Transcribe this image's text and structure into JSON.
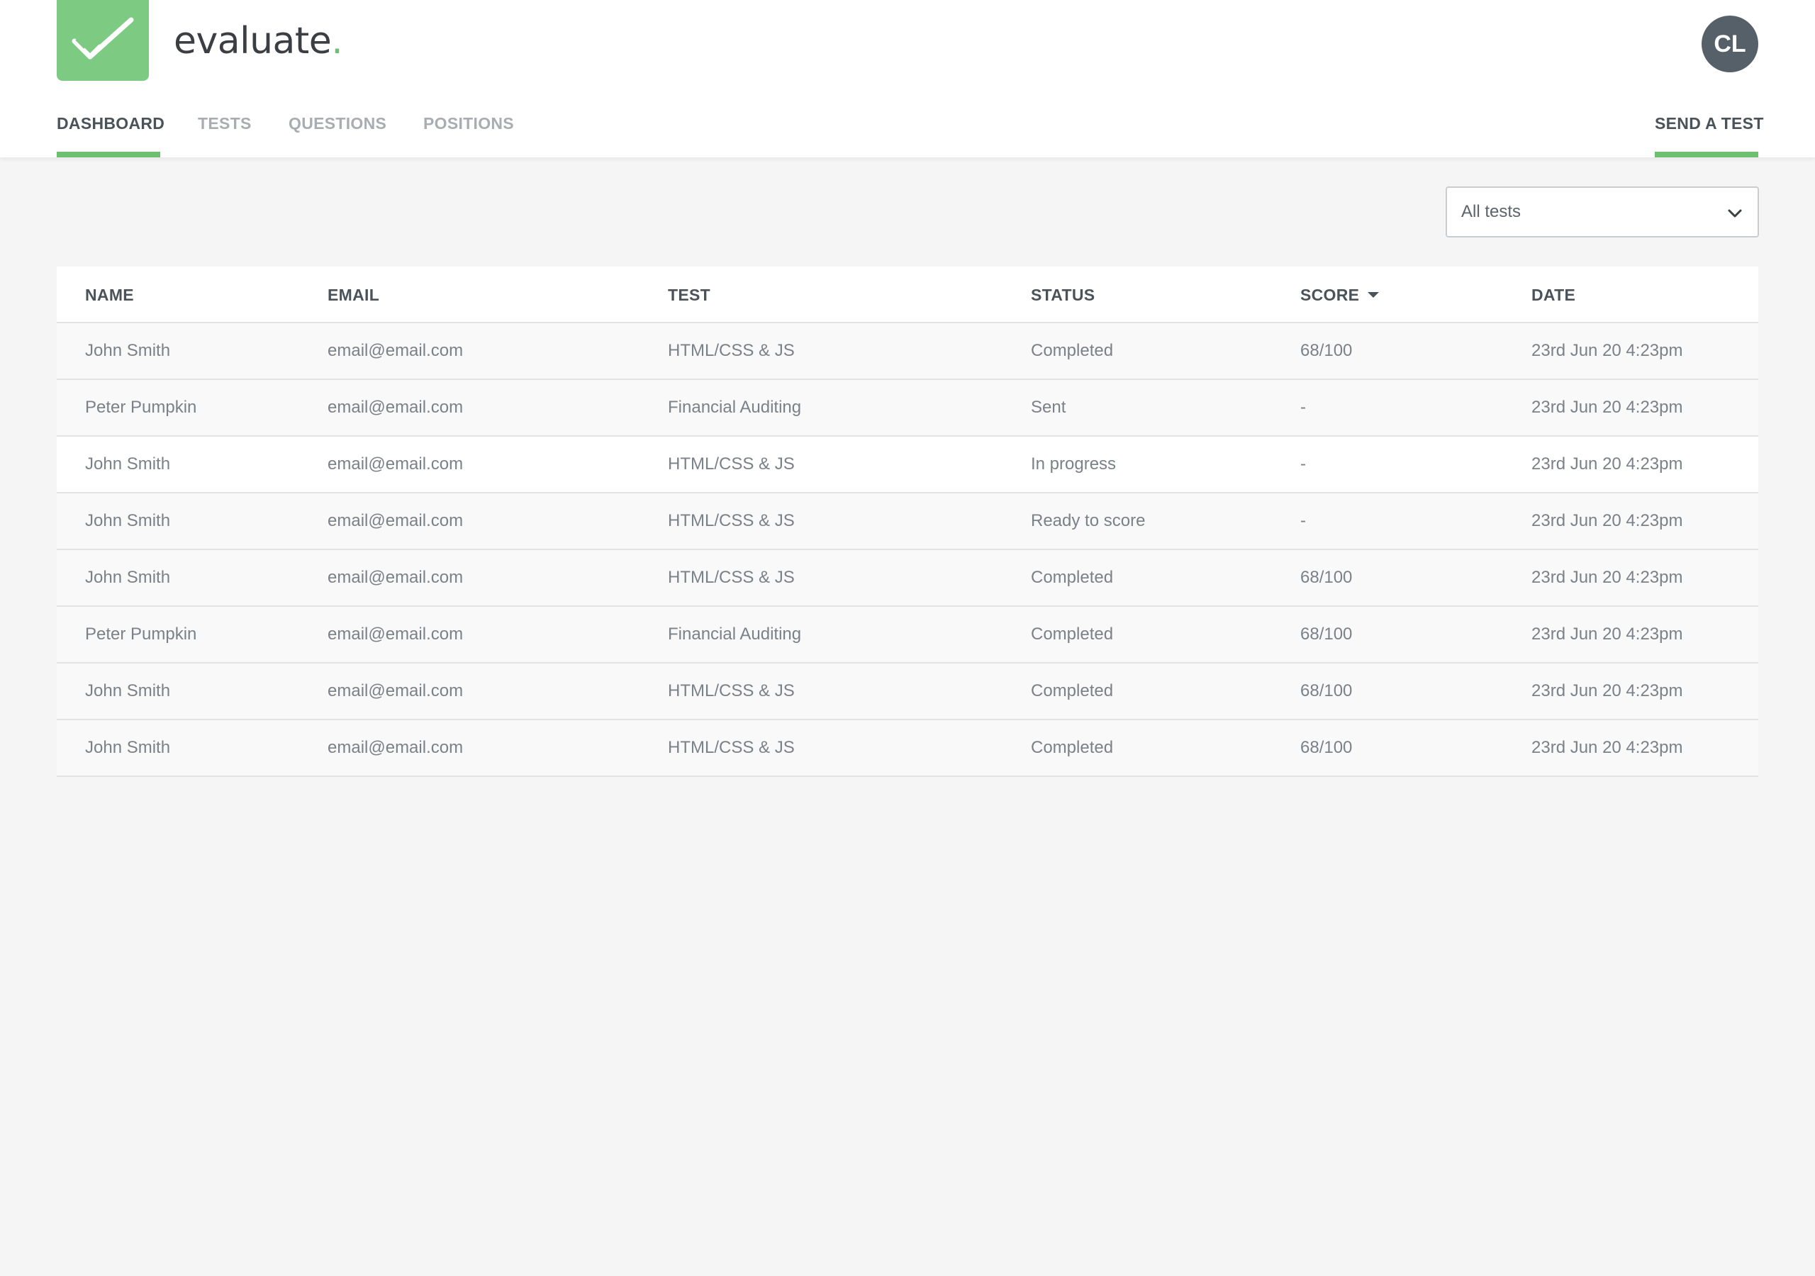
{
  "app": {
    "name": "evaluate",
    "name_dot": ".",
    "accent_color": "#6cc070",
    "logo_icon": "double-check-icon"
  },
  "user": {
    "initials": "CL"
  },
  "nav": {
    "items": [
      {
        "label": "DASHBOARD",
        "active": true
      },
      {
        "label": "TESTS",
        "active": false
      },
      {
        "label": "QUESTIONS",
        "active": false
      },
      {
        "label": "POSITIONS",
        "active": false
      }
    ],
    "send_test_label": "SEND A TEST"
  },
  "filter": {
    "selected": "All tests",
    "icon": "chevron-down-icon"
  },
  "table": {
    "columns": [
      "NAME",
      "EMAIL",
      "TEST",
      "STATUS",
      "SCORE",
      "DATE"
    ],
    "sort": {
      "column": "SCORE",
      "direction": "desc"
    },
    "rows": [
      [
        "John Smith",
        "email@email.com",
        "HTML/CSS & JS",
        "Completed",
        "68/100",
        "23rd Jun 20 4:23pm"
      ],
      [
        "Peter Pumpkin",
        "email@email.com",
        "Financial Auditing",
        "Sent",
        "-",
        "23rd Jun 20 4:23pm"
      ],
      [
        "John Smith",
        "email@email.com",
        "HTML/CSS & JS",
        "In progress",
        "-",
        "23rd Jun 20 4:23pm"
      ],
      [
        "John Smith",
        "email@email.com",
        "HTML/CSS & JS",
        "Ready to score",
        "-",
        "23rd Jun 20 4:23pm"
      ],
      [
        "John Smith",
        "email@email.com",
        "HTML/CSS & JS",
        "Completed",
        "68/100",
        "23rd Jun 20 4:23pm"
      ],
      [
        "Peter Pumpkin",
        "email@email.com",
        "Financial Auditing",
        "Completed",
        "68/100",
        "23rd Jun 20 4:23pm"
      ],
      [
        "John Smith",
        "email@email.com",
        "HTML/CSS & JS",
        "Completed",
        "68/100",
        "23rd Jun 20 4:23pm"
      ],
      [
        "John Smith",
        "email@email.com",
        "HTML/CSS & JS",
        "Completed",
        "68/100",
        "23rd Jun 20 4:23pm"
      ]
    ]
  }
}
